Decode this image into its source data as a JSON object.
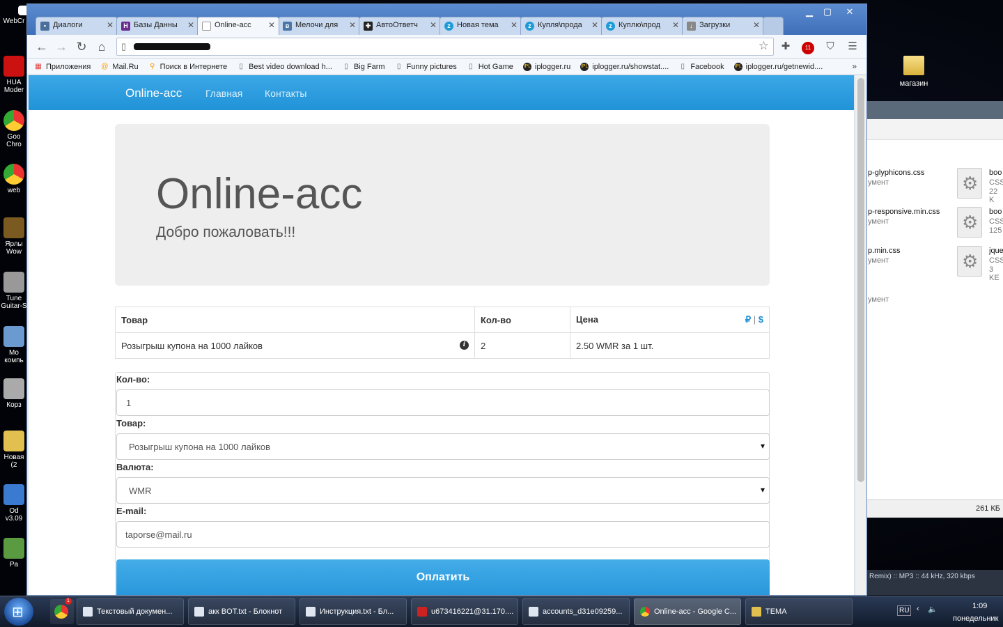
{
  "desktop": {
    "left_icons": [
      "WebCr",
      "HUA Moder",
      "Goo Chro",
      "web",
      "Ярлы Wow",
      "Tune Guitar-S",
      "Мо компь",
      "Корз",
      "Новая (2",
      "Od v3.09",
      "Pa"
    ],
    "folder_label": "магазин",
    "explorer": {
      "left_files": [
        {
          "name": "p-glyphicons.css",
          "sub": "умент"
        },
        {
          "name": "p-responsive.min.css",
          "sub": "умент"
        },
        {
          "name": "p.min.css",
          "sub": "умент"
        },
        {
          "name": "",
          "sub": "умент"
        }
      ],
      "right_files": [
        {
          "name": "boo",
          "type": "CSS",
          "size": "22 K"
        },
        {
          "name": "boo",
          "type": "CSS",
          "size": "125"
        },
        {
          "name": "jque",
          "type": "CSS",
          "size": "3 KE"
        }
      ],
      "status": "261 КБ"
    },
    "media_text": "Remix) :: MP3 :: 44 kHz, 320 kbps"
  },
  "browser": {
    "window_controls": [
      "minimize",
      "maximize",
      "close"
    ],
    "tabs": [
      {
        "label": "Диалоги",
        "fav_color": "#4a6f9a",
        "fav": "▪"
      },
      {
        "label": "Базы Данны",
        "fav_color": "#6a2d8f",
        "fav": "H"
      },
      {
        "label": "Online-acc",
        "fav_color": "#ffffff",
        "fav": "",
        "active": true
      },
      {
        "label": "Мелочи для",
        "fav_color": "#4a76a8",
        "fav": "в"
      },
      {
        "label": "АвтоОтветч",
        "fav_color": "#222222",
        "fav": "✚"
      },
      {
        "label": "Новая тема",
        "fav_color": "#1e9bd7",
        "fav": "z"
      },
      {
        "label": "Купля\\прода",
        "fav_color": "#1e9bd7",
        "fav": "z"
      },
      {
        "label": "Куплю\\прод",
        "fav_color": "#1e9bd7",
        "fav": "z"
      },
      {
        "label": "Загрузки",
        "fav_color": "#888888",
        "fav": "↓"
      }
    ],
    "bookmarks": [
      {
        "label": "Приложения",
        "icon": "apps-grid"
      },
      {
        "label": "Mail.Ru",
        "icon": "at"
      },
      {
        "label": "Поиск в Интернете",
        "icon": "search"
      },
      {
        "label": "Best video download h...",
        "icon": "page"
      },
      {
        "label": "Big Farm",
        "icon": "page"
      },
      {
        "label": "Funny pictures",
        "icon": "page"
      },
      {
        "label": "Hot Game",
        "icon": "page"
      },
      {
        "label": "iplogger.ru",
        "icon": "ipl"
      },
      {
        "label": "iplogger.ru/showstat....",
        "icon": "ipl"
      },
      {
        "label": "Facebook",
        "icon": "page"
      },
      {
        "label": "iplogger.ru/getnewid....",
        "icon": "ipl"
      }
    ],
    "bookmarks_more": "»",
    "extension_badge": "11"
  },
  "site": {
    "brand": "Online-acc",
    "nav": [
      "Главная",
      "Контакты"
    ],
    "jumbotron": {
      "title": "Online-acc",
      "subtitle": "Добро пожаловать!!!"
    },
    "table": {
      "headers": [
        "Товар",
        "Кол-во",
        "Цена"
      ],
      "currency_switch": [
        "₽",
        "|",
        "$"
      ],
      "rows": [
        {
          "product": "Розыгрыш купона на 1000 лайков",
          "qty": "2",
          "price": "2.50 WMR за 1 шт."
        }
      ]
    },
    "form": {
      "qty_label": "Кол-во:",
      "qty_value": "1",
      "product_label": "Товар:",
      "product_value": "Розыгрыш купона на 1000 лайков",
      "currency_label": "Валюта:",
      "currency_value": "WMR",
      "email_label": "E-mail:",
      "email_value": "taporse@mail.ru",
      "pay_label": "Оплатить"
    }
  },
  "taskbar": {
    "items": [
      {
        "label": "Текстовый докумен..."
      },
      {
        "label": "акк BOT.txt - Блокнот"
      },
      {
        "label": "Инструкция.txt - Бл..."
      },
      {
        "label": "u673416221@31.170...."
      },
      {
        "label": "accounts_d31e09259..."
      },
      {
        "label": "Online-acc - Google C...",
        "active": true
      },
      {
        "label": "ТЕМА"
      }
    ],
    "chrome_badge": "1",
    "lang": "RU",
    "time": "1:09",
    "day": "понедельник"
  }
}
